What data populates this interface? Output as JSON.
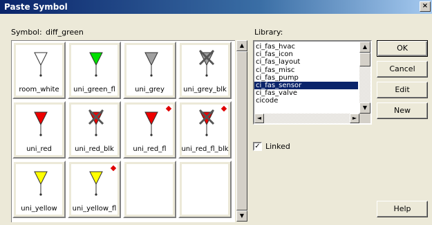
{
  "window": {
    "title": "Paste Symbol",
    "close": "×"
  },
  "symbol": {
    "label": "Symbol:",
    "value": "diff_green"
  },
  "symbols": [
    {
      "name": "room_white",
      "color": "#ffffff",
      "crossed": false,
      "linked_marker": false
    },
    {
      "name": "uni_green_fl",
      "color": "#00e000",
      "crossed": false,
      "linked_marker": false
    },
    {
      "name": "uni_grey",
      "color": "#a0a0a0",
      "crossed": false,
      "linked_marker": false
    },
    {
      "name": "uni_grey_blk",
      "color": "#a0a0a0",
      "crossed": true,
      "linked_marker": false
    },
    {
      "name": "uni_red",
      "color": "#ee0000",
      "crossed": false,
      "linked_marker": false
    },
    {
      "name": "uni_red_blk",
      "color": "#ee0000",
      "crossed": true,
      "linked_marker": false
    },
    {
      "name": "uni_red_fl",
      "color": "#ee0000",
      "crossed": false,
      "linked_marker": true
    },
    {
      "name": "uni_red_fl_blk",
      "color": "#ee0000",
      "crossed": true,
      "linked_marker": true
    },
    {
      "name": "uni_yellow",
      "color": "#ffff00",
      "crossed": false,
      "linked_marker": false
    },
    {
      "name": "uni_yellow_fl",
      "color": "#ffff00",
      "crossed": false,
      "linked_marker": true
    },
    {
      "name": "",
      "color": "",
      "crossed": false,
      "linked_marker": false
    },
    {
      "name": "",
      "color": "",
      "crossed": false,
      "linked_marker": false
    }
  ],
  "library": {
    "label": "Library:",
    "items": [
      "ci_fas_hvac",
      "ci_fas_icon",
      "ci_fas_layout",
      "ci_fas_misc",
      "ci_fas_pump",
      "ci_fas_sensor",
      "ci_fas_valve",
      "cicode"
    ],
    "selected": "ci_fas_sensor"
  },
  "linked": {
    "label": "Linked",
    "checked": true
  },
  "buttons": {
    "ok": "OK",
    "cancel": "Cancel",
    "edit": "Edit",
    "new": "New",
    "help": "Help"
  },
  "colors": {
    "selection": "#0a246a",
    "marker": "#e00000"
  }
}
